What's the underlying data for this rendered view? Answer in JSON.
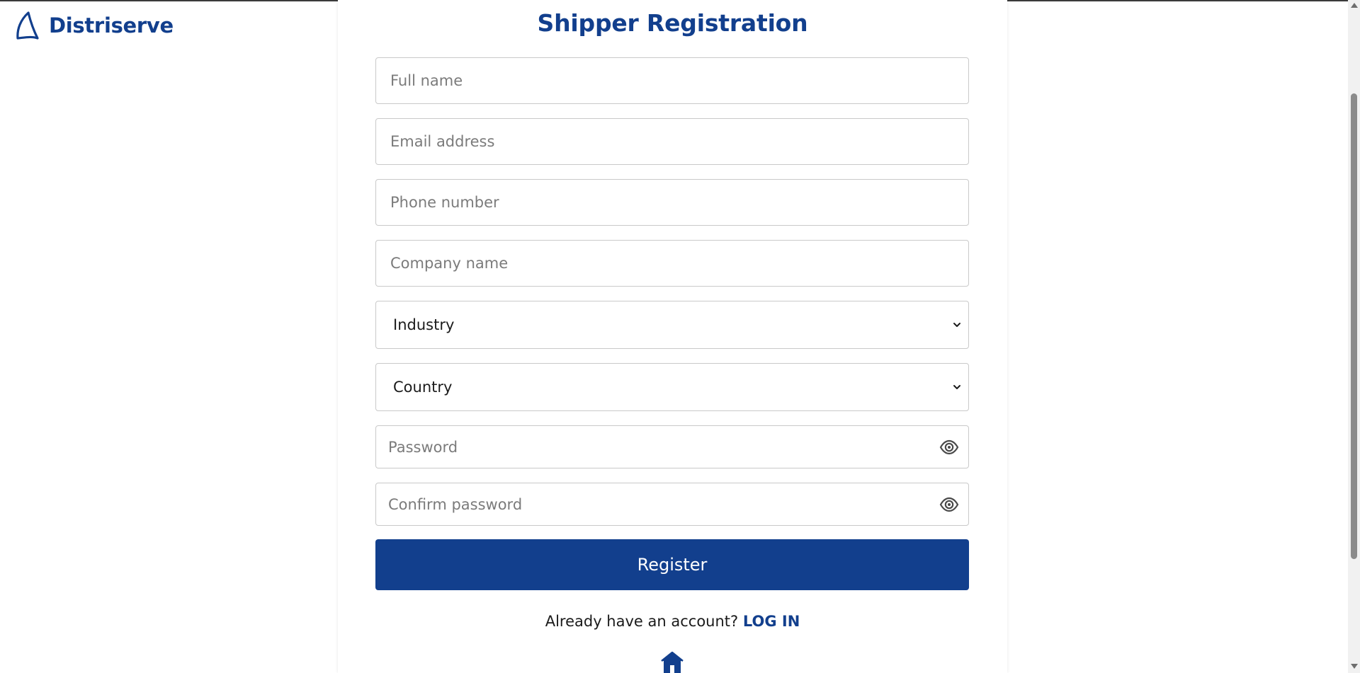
{
  "brand": {
    "name": "Distriserve",
    "logo_icon": "sail-logo-icon",
    "color": "#123f8d"
  },
  "form": {
    "title": "Shipper Registration",
    "full_name_placeholder": "Full name",
    "email_placeholder": "Email address",
    "phone_placeholder": "Phone number",
    "company_placeholder": "Company name",
    "industry_selected": "Industry",
    "country_selected": "Country",
    "password_placeholder": "Password",
    "confirm_password_placeholder": "Confirm password",
    "register_label": "Register",
    "login_prompt": "Already have an account?",
    "login_link": "LOG IN"
  },
  "icons": {
    "select_chevron": "chevron-down-icon",
    "password_toggle": "eye-icon",
    "home": "home-icon"
  },
  "colors": {
    "primary": "#123f8d",
    "field_border": "#c9c9c9",
    "placeholder": "#7b7b7b"
  }
}
